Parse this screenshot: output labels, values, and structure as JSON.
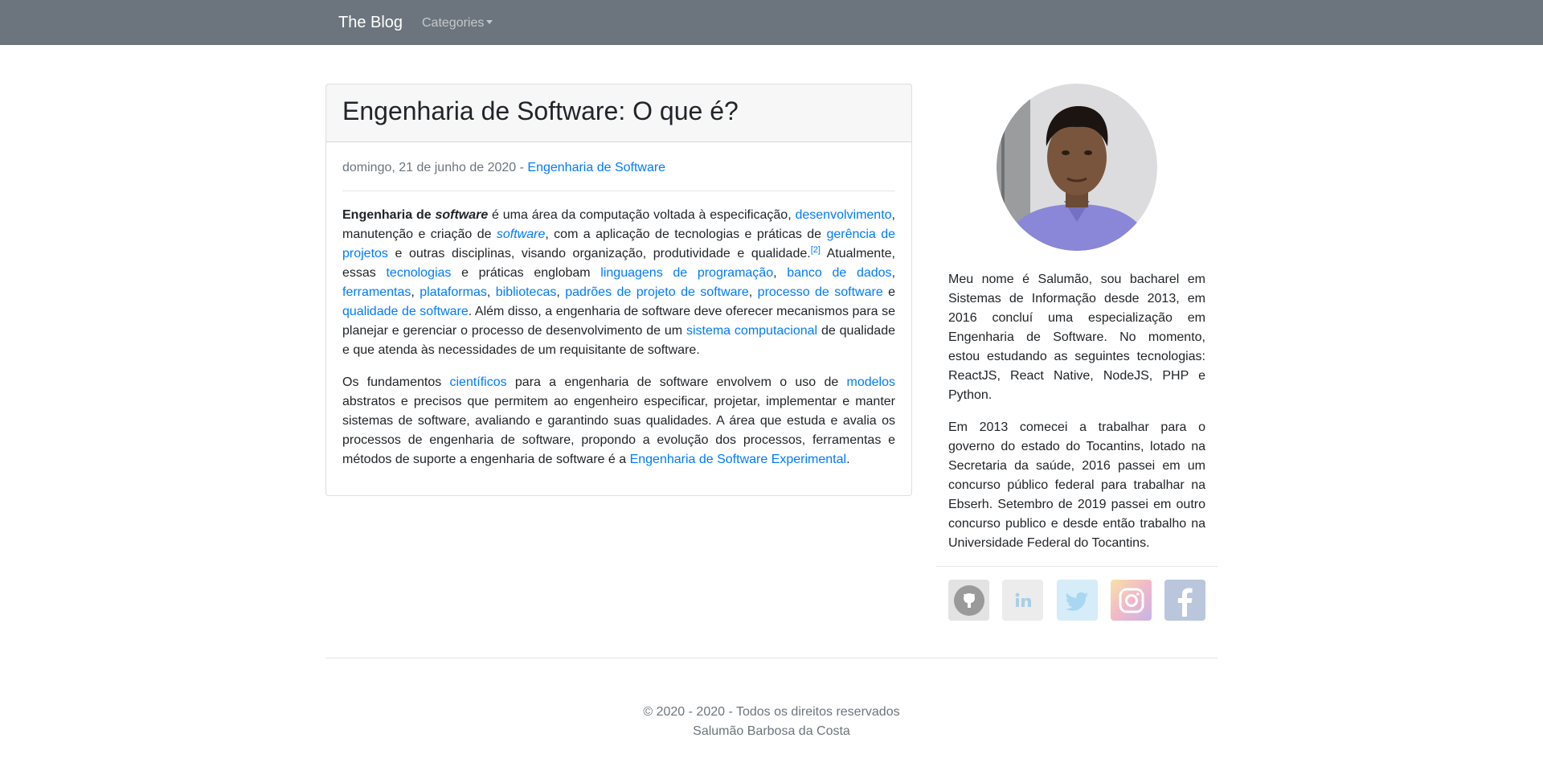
{
  "navbar": {
    "brand": "The Blog",
    "categories_label": "Categories"
  },
  "post": {
    "title": "Engenharia de Software: O que é?",
    "date": "domingo, 21 de junho de 2020",
    "separator": " - ",
    "category_link": "Engenharia de Software",
    "p1": {
      "t1": "Engenharia de ",
      "t2": "software",
      "t3": " é uma área da computação voltada à especificação, ",
      "l1": "desenvolvimento",
      "t4": ", manutenção e criação de ",
      "l2": "software",
      "t5": ", com a aplicação de tecnologias e práticas de ",
      "l3": "gerência de projetos",
      "t6": " e outras disciplinas, visando organização, produtividade e qualidade.",
      "ref": "[2]",
      "t7": " Atualmente, essas ",
      "l4": "tecnologias",
      "t8": " e práticas englobam ",
      "l5": "linguagens de programação",
      "t9": ", ",
      "l6": "banco de dados",
      "t10": ", ",
      "l7": "ferramentas",
      "t11": ", ",
      "l8": "plataformas",
      "t12": ", ",
      "l9": "bibliotecas",
      "t13": ", ",
      "l10": "padrões de projeto de software",
      "t14": ", ",
      "l11": "processo de software",
      "t15": " e ",
      "l12": "qualidade de software",
      "t16": ". Além disso, a engenharia de software deve oferecer mecanismos para se planejar e gerenciar o processo de desenvolvimento de um ",
      "l13": "sistema computacional",
      "t17": " de qualidade e que atenda às necessidades de um requisitante de software."
    },
    "p2": {
      "t1": "Os fundamentos ",
      "l1": "científicos",
      "t2": " para a engenharia de software envolvem o uso de ",
      "l2": "modelos",
      "t3": " abstratos e precisos que permitem ao engenheiro especificar, projetar, implementar e manter sistemas de software, avaliando e garantindo suas qualidades. A área que estuda e avalia os processos de engenharia de software, propondo a evolução dos processos, ferramentas e métodos de suporte a engenharia de software é a ",
      "l3": "Engenharia de Software Experimental",
      "t4": "."
    }
  },
  "sidebar": {
    "about_p1": "Meu nome é Salumão, sou bacharel em Sistemas de Informação desde 2013, em 2016 concluí uma especialização em Engenharia de Software. No momento, estou estudando as seguintes tecnologias: ReactJS, React Native, NodeJS, PHP e Python.",
    "about_p2": "Em 2013 comecei a trabalhar para o governo do estado do Tocantins, lotado na Secretaria da saúde, 2016 passei em um concurso público federal para trabalhar na Ebserh. Setembro de 2019 passei em outro concurso publico e desde então trabalho na Universidade Federal do Tocantins.",
    "social": [
      {
        "icon": "github-icon",
        "color": "#8a8a8a"
      },
      {
        "icon": "linkedin-icon",
        "color": "#9cc8e3"
      },
      {
        "icon": "twitter-icon",
        "color": "#a9d7f2"
      },
      {
        "icon": "instagram-icon",
        "color": "#ffffff"
      },
      {
        "icon": "facebook-icon",
        "color": "#ffffff"
      }
    ]
  },
  "footer": {
    "line1": "© 2020 - 2020 - Todos os direitos reservados",
    "line2": "Salumão Barbosa da Costa"
  }
}
